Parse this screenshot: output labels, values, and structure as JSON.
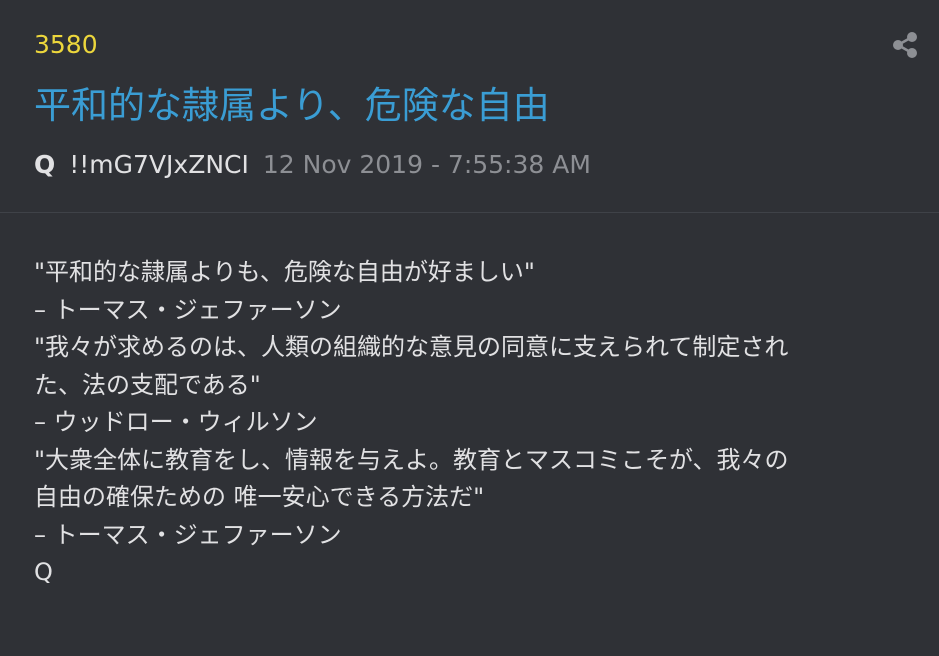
{
  "post": {
    "number": "3580",
    "title": "平和的な隷属より、危険な自由",
    "author": "Q",
    "tripcode": "!!mG7VJxZNCI",
    "timestamp": "12 Nov 2019 - 7:55:38 AM",
    "share_icon": "share-icon",
    "lines": [
      "\"平和的な隷属よりも、危険な自由が好ましい\"",
      "– トーマス・ジェファーソン",
      "\"我々が求めるのは、人類の組織的な意見の同意に支えられて制定され",
      "た、法の支配である\"",
      "– ウッドロー・ウィルソン",
      "\"大衆全体に教育をし、情報を与えよ。教育とマスコミこそが、我々の",
      "自由の確保ための 唯一安心できる方法だ\"",
      "– トーマス・ジェファーソン",
      "Q"
    ]
  },
  "colors": {
    "background": "#2f3136",
    "number": "#ecd63c",
    "title": "#3a9dd4",
    "text": "#e1e1e3",
    "muted": "#8d8f94"
  }
}
